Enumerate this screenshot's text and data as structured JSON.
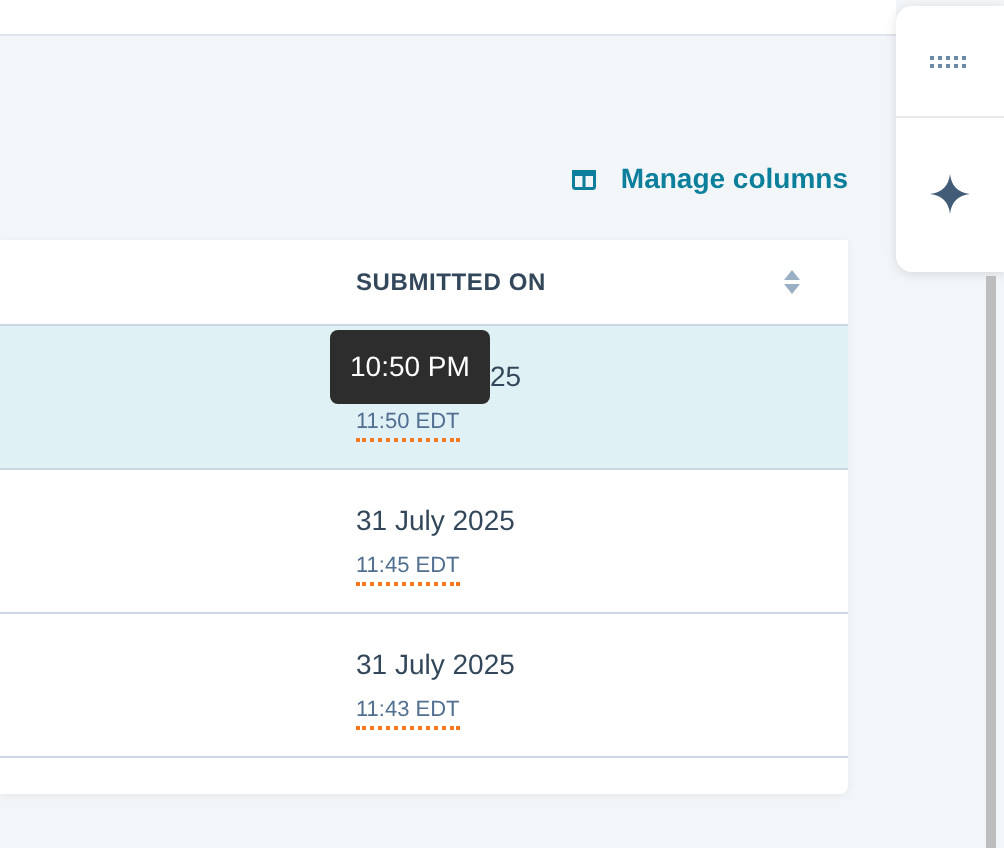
{
  "toolbar": {
    "manage_columns": "Manage columns"
  },
  "table": {
    "columns": [
      {
        "label": "SUBMITTED ON"
      }
    ],
    "rows": [
      {
        "selected": true,
        "date": "25",
        "date_covered": true,
        "time": "11:50 EDT"
      },
      {
        "selected": false,
        "date": "31 July 2025",
        "date_covered": false,
        "time": "11:45 EDT"
      },
      {
        "selected": false,
        "date": "31 July 2025",
        "date_covered": false,
        "time": "11:43 EDT"
      }
    ]
  },
  "tooltip": {
    "text": "10:50 PM"
  }
}
